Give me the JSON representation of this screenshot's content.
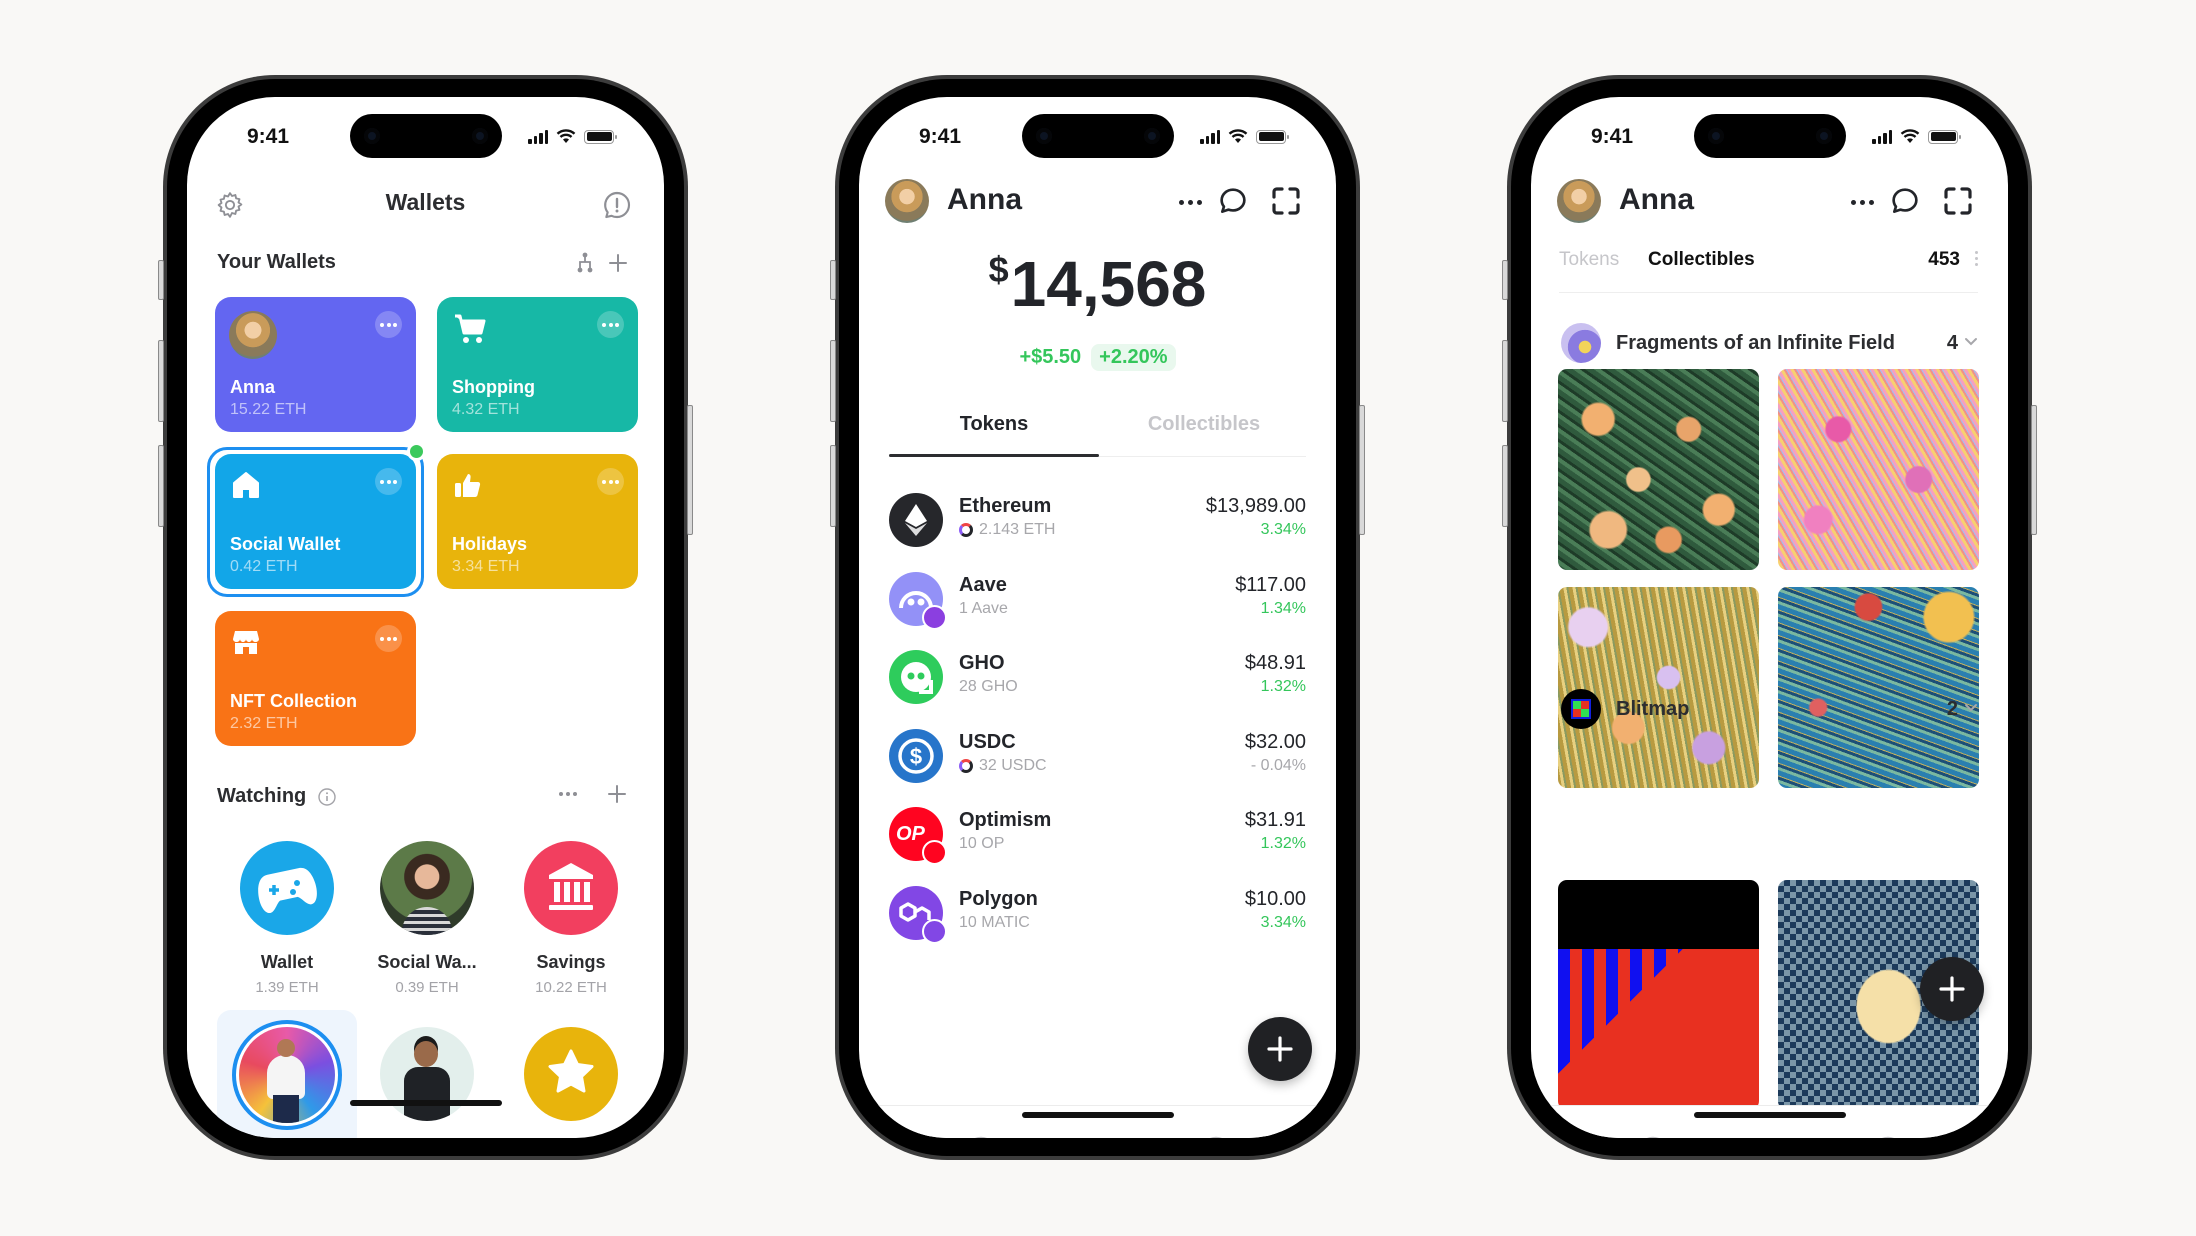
{
  "status_bar": {
    "time": "9:41"
  },
  "wallets_screen": {
    "title": "Wallets",
    "settings_icon": "gear-icon",
    "feedback_icon": "alert-bubble-icon",
    "your_wallets": {
      "label": "Your Wallets",
      "wallets": [
        {
          "name": "Anna",
          "balance": "15.22 ETH",
          "color": "#6366f1",
          "icon": "avatar-photo"
        },
        {
          "name": "Shopping",
          "balance": "4.32 ETH",
          "color": "#17b8a6",
          "icon": "cart-icon"
        },
        {
          "name": "Social Wallet",
          "balance": "0.42 ETH",
          "color": "#12a6e8",
          "icon": "home-icon",
          "selected": true,
          "online": true
        },
        {
          "name": "Holidays",
          "balance": "3.34 ETH",
          "color": "#e8b40c",
          "icon": "thumbs-up-icon"
        },
        {
          "name": "NFT Collection",
          "balance": "2.32 ETH",
          "color": "#f97316",
          "icon": "store-icon"
        }
      ]
    },
    "watching": {
      "label": "Watching",
      "items": [
        {
          "name": "Wallet",
          "balance": "1.39 ETH",
          "color": "#1aa7e8",
          "icon": "gamepad-icon"
        },
        {
          "name": "Social Wa...",
          "balance": "0.39 ETH",
          "icon": "avatar-photo"
        },
        {
          "name": "Savings",
          "balance": "10.22 ETH",
          "color": "#f23f5f",
          "icon": "bank-icon"
        },
        {
          "icon": "avatar-photo",
          "selected": true
        },
        {
          "icon": "avatar-photo"
        },
        {
          "color": "#e8b40c",
          "icon": "star-icon"
        }
      ]
    }
  },
  "tokens_screen": {
    "user": "Anna",
    "balance": {
      "currency": "$",
      "amount": "14,568"
    },
    "change": {
      "amount": "+$5.50",
      "percent": "+2.20%"
    },
    "tabs": [
      {
        "label": "Tokens",
        "active": true
      },
      {
        "label": "Collectibles",
        "active": false
      }
    ],
    "tokens": [
      {
        "name": "Ethereum",
        "amount": "2.143 ETH",
        "value": "$13,989.00",
        "change": "3.34%",
        "positive": true,
        "color": "#26272b",
        "multichain": true
      },
      {
        "name": "Aave",
        "amount": "1 Aave",
        "value": "$117.00",
        "change": "1.34%",
        "positive": true,
        "color": "#9391f7",
        "badge": "#8b3fe0"
      },
      {
        "name": "GHO",
        "amount": "28 GHO",
        "value": "$48.91",
        "change": "1.32%",
        "positive": true,
        "color": "#2ecc5c"
      },
      {
        "name": "USDC",
        "amount": "32 USDC",
        "value": "$32.00",
        "change": "- 0.04%",
        "positive": false,
        "color": "#2775ca",
        "multichain": true
      },
      {
        "name": "Optimism",
        "amount": "10 OP",
        "value": "$31.91",
        "change": "1.32%",
        "positive": true,
        "color": "#ff0420",
        "badge": "#ff0420"
      },
      {
        "name": "Polygon",
        "amount": "10 MATIC",
        "value": "$10.00",
        "change": "3.34%",
        "positive": true,
        "color": "#8247e5",
        "badge": "#8247e5"
      }
    ],
    "bottom_tabs": [
      "clock-icon",
      "wallet-icon",
      "compass-icon"
    ]
  },
  "collectibles_screen": {
    "user": "Anna",
    "tabs": [
      {
        "label": "Tokens",
        "active": false
      },
      {
        "label": "Collectibles",
        "active": true
      }
    ],
    "total_count": "453",
    "collections": [
      {
        "name": "Fragments of an Infinite Field",
        "count": "4"
      },
      {
        "name": "Blitmap",
        "count": "2"
      }
    ],
    "bottom_tabs": [
      "clock-icon",
      "wallet-icon",
      "globe-icon"
    ]
  }
}
